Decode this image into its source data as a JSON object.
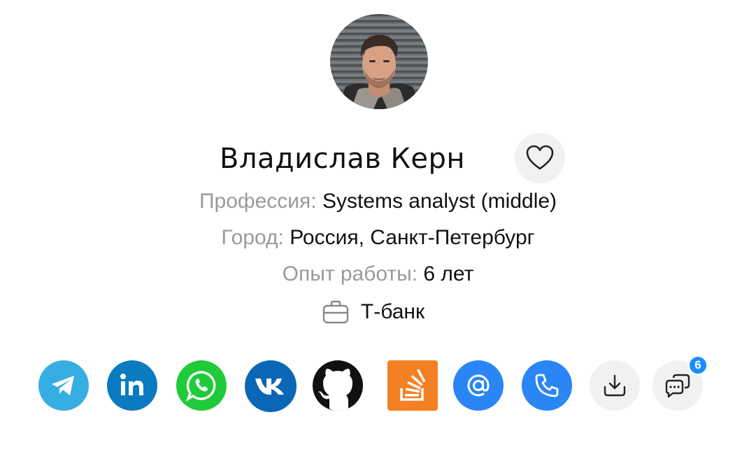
{
  "profile": {
    "name": "Владислав Керн",
    "avatar_alt": "profile photo"
  },
  "info": {
    "profession_label": "Профессия:",
    "profession_value": "Systems analyst (middle)",
    "city_label": "Город:",
    "city_value": "Россия, Санкт-Петербург",
    "experience_label": "Опыт работы:",
    "experience_value": "6 лет",
    "company": "Т-банк"
  },
  "socials": [
    {
      "name": "telegram",
      "color": "#37aee2"
    },
    {
      "name": "linkedin",
      "color": "#0a7bbf"
    },
    {
      "name": "whatsapp",
      "color": "#1fcb3a"
    },
    {
      "name": "vk",
      "color": "#0a67b6"
    },
    {
      "name": "github",
      "color": "#111111"
    },
    {
      "name": "stackoverflow",
      "color": "#f48024"
    },
    {
      "name": "email",
      "color": "#2a86f5"
    },
    {
      "name": "phone",
      "color": "#2a86f5"
    },
    {
      "name": "download",
      "color": "#f1f1f1"
    },
    {
      "name": "comments",
      "color": "#f1f1f1"
    }
  ],
  "comments_count": "6"
}
